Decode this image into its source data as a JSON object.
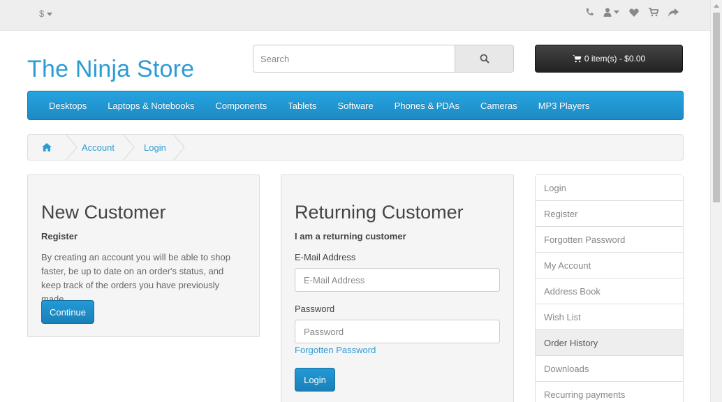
{
  "topbar": {
    "currency": "$",
    "icons": [
      "phone-icon",
      "user-icon",
      "heart-icon",
      "cart-icon",
      "share-icon"
    ]
  },
  "header": {
    "logo": "The Ninja Store",
    "search_placeholder": "Search",
    "cart_label": "0 item(s) - $0.00"
  },
  "menu": {
    "items": [
      "Desktops",
      "Laptops & Notebooks",
      "Components",
      "Tablets",
      "Software",
      "Phones & PDAs",
      "Cameras",
      "MP3 Players"
    ]
  },
  "breadcrumb": {
    "items": [
      "Account",
      "Login"
    ]
  },
  "new_customer": {
    "title": "New Customer",
    "subtitle": "Register",
    "text": "By creating an account you will be able to shop faster, be up to date on an order's status, and keep track of the orders you have previously made.",
    "button": "Continue"
  },
  "returning_customer": {
    "title": "Returning Customer",
    "subtitle": "I am a returning customer",
    "email_label": "E-Mail Address",
    "email_placeholder": "E-Mail Address",
    "password_label": "Password",
    "password_placeholder": "Password",
    "forgot_link": "Forgotten Password",
    "button": "Login"
  },
  "sidebar": {
    "items": [
      "Login",
      "Register",
      "Forgotten Password",
      "My Account",
      "Address Book",
      "Wish List",
      "Order History",
      "Downloads",
      "Recurring payments"
    ],
    "active": "Order History"
  },
  "colors": {
    "accent": "#2b9cd4",
    "menu": "#229ad6",
    "cart": "#333333"
  }
}
